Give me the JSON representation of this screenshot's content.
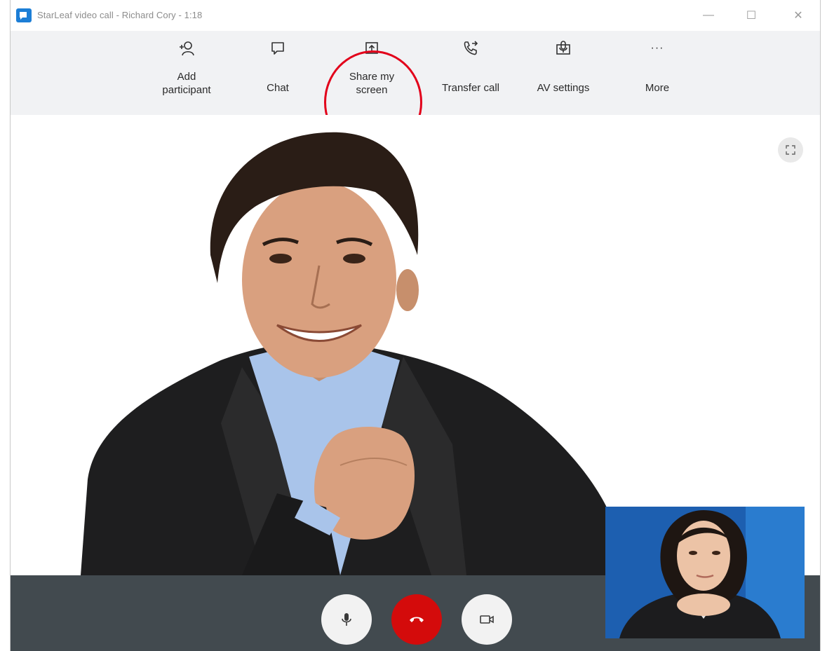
{
  "window": {
    "title": "StarLeaf video call - Richard Cory - 1:18",
    "minimize_glyph": "—",
    "maximize_glyph": "☐",
    "close_glyph": "✕"
  },
  "toolbar": {
    "items": [
      {
        "id": "add-participant",
        "label_line1": "Add",
        "label_line2": "participant",
        "icon": "add-person-icon"
      },
      {
        "id": "chat",
        "label": "Chat",
        "icon": "chat-bubble-icon"
      },
      {
        "id": "share-screen",
        "label_line1": "Share my",
        "label_line2": "screen",
        "icon": "share-screen-icon",
        "highlighted": true
      },
      {
        "id": "transfer-call",
        "label": "Transfer call",
        "icon": "phone-transfer-icon"
      },
      {
        "id": "av-settings",
        "label": "AV settings",
        "icon": "av-settings-icon"
      },
      {
        "id": "more",
        "label": "More",
        "icon": "more-dots-icon"
      }
    ],
    "more_glyph": "···"
  },
  "video": {
    "remote_participant": "Richard Cory",
    "fullscreen_icon": "expand-icon"
  },
  "controls": {
    "mic_icon": "microphone-icon",
    "hangup_icon": "hang-up-icon",
    "camera_icon": "camera-icon"
  },
  "colors": {
    "highlight": "#e2001a",
    "hangup": "#d40b0b",
    "control_bar": "#424a4f",
    "toolbar_bg": "#f1f2f4",
    "app_icon": "#1c7ed6",
    "self_view_bg": "#1d5fb0"
  }
}
